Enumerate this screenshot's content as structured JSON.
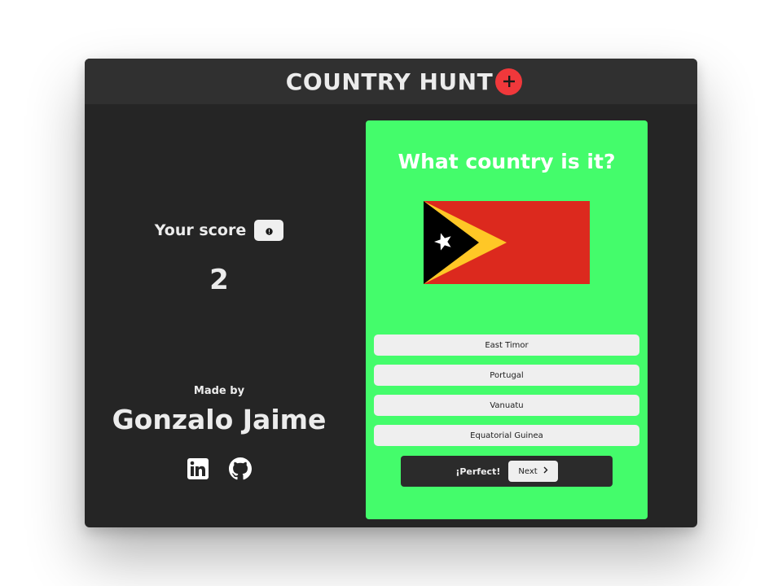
{
  "app": {
    "title": "COUNTRY HUNT",
    "title_icon": "plus-icon",
    "accent_color": "#f0383b"
  },
  "score": {
    "label": "Your score",
    "info_icon": "info-icon",
    "value": "2"
  },
  "credits": {
    "made_by_label": "Made by",
    "author": "Gonzalo Jaime",
    "links": [
      {
        "name": "linkedin-icon"
      },
      {
        "name": "github-icon"
      }
    ]
  },
  "quiz": {
    "question": "What country is it?",
    "card_color": "#44fc6b",
    "flag": {
      "icon": "timor-leste-flag",
      "colors": {
        "field": "#dc291e",
        "triangle_outer": "#ffc726",
        "triangle_inner": "#000000",
        "star": "#ffffff"
      }
    },
    "options": [
      {
        "label": "East Timor"
      },
      {
        "label": "Portugal"
      },
      {
        "label": "Vanuatu"
      },
      {
        "label": "Equatorial Guinea"
      }
    ],
    "result": {
      "text": "¡Perfect!",
      "next_label": "Next",
      "next_icon": "chevron-right-icon"
    }
  }
}
